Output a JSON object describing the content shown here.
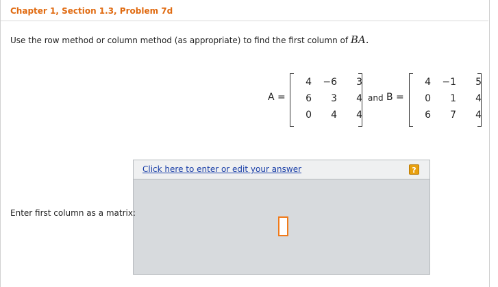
{
  "problem": {
    "title": "Chapter 1, Section 1.3, Problem 7d",
    "prompt_text": "Use the row method or column method (as appropriate) to find the first column of ",
    "prompt_math": "BA."
  },
  "matrices": {
    "a_label": "A =",
    "a_rows": [
      [
        "4",
        "−6",
        "3"
      ],
      [
        "6",
        "3",
        "4"
      ],
      [
        "0",
        "4",
        "4"
      ]
    ],
    "and_text": "and",
    "b_label": "B =",
    "b_rows": [
      [
        "4",
        "−1",
        "5"
      ],
      [
        "0",
        "1",
        "4"
      ],
      [
        "6",
        "7",
        "4"
      ]
    ]
  },
  "answer": {
    "link_text": "Click here to enter or edit your answer",
    "help_symbol": "?",
    "entry_label": "Enter first column as a matrix:"
  },
  "colors": {
    "title": "#e06a10",
    "link": "#1a3fa8",
    "panel": "#d7dadd",
    "input_border": "#f07a1a",
    "help_icon": "#e8a010"
  }
}
